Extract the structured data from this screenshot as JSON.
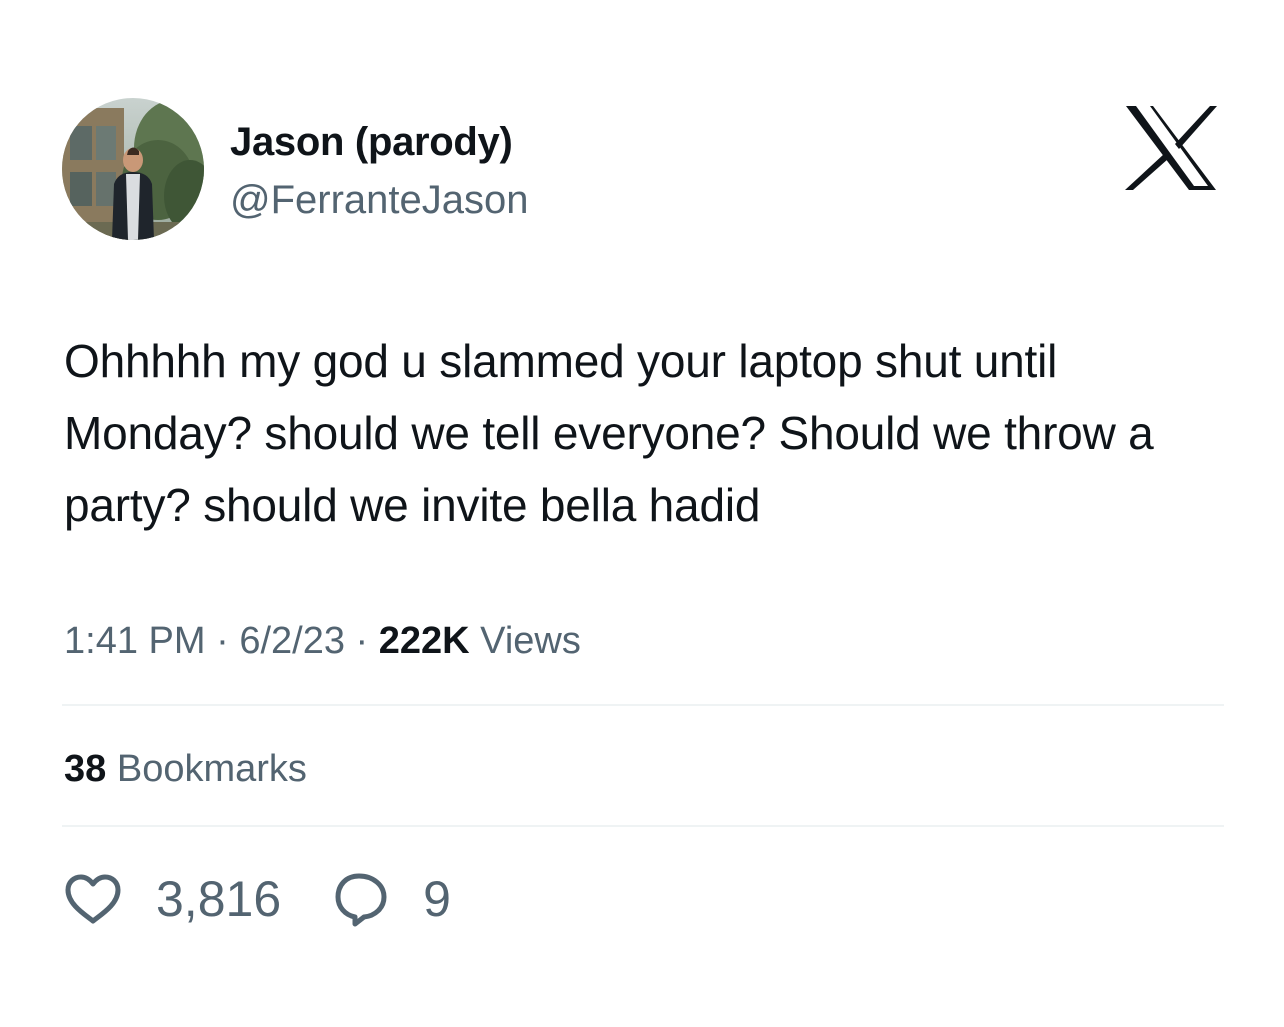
{
  "author": {
    "display_name": "Jason (parody)",
    "handle": "@FerranteJason"
  },
  "brand": {
    "logo_icon": "x-logo-icon"
  },
  "tweet": {
    "text": "Ohhhhh my god u slammed your laptop shut until Monday? should we tell everyone? Should we throw a party? should we invite bella hadid"
  },
  "meta": {
    "time": "1:41 PM",
    "separator": "·",
    "date": "6/2/23",
    "views_count": "222K",
    "views_label": "Views"
  },
  "bookmarks": {
    "count": "38",
    "label": "Bookmarks"
  },
  "actions": {
    "likes": {
      "icon": "heart-icon",
      "count": "3,816"
    },
    "replies": {
      "icon": "reply-bubble-icon",
      "count": "9"
    }
  },
  "colors": {
    "text_primary": "#0f1419",
    "text_secondary": "#536471",
    "divider": "#eff3f4",
    "background": "#ffffff"
  }
}
